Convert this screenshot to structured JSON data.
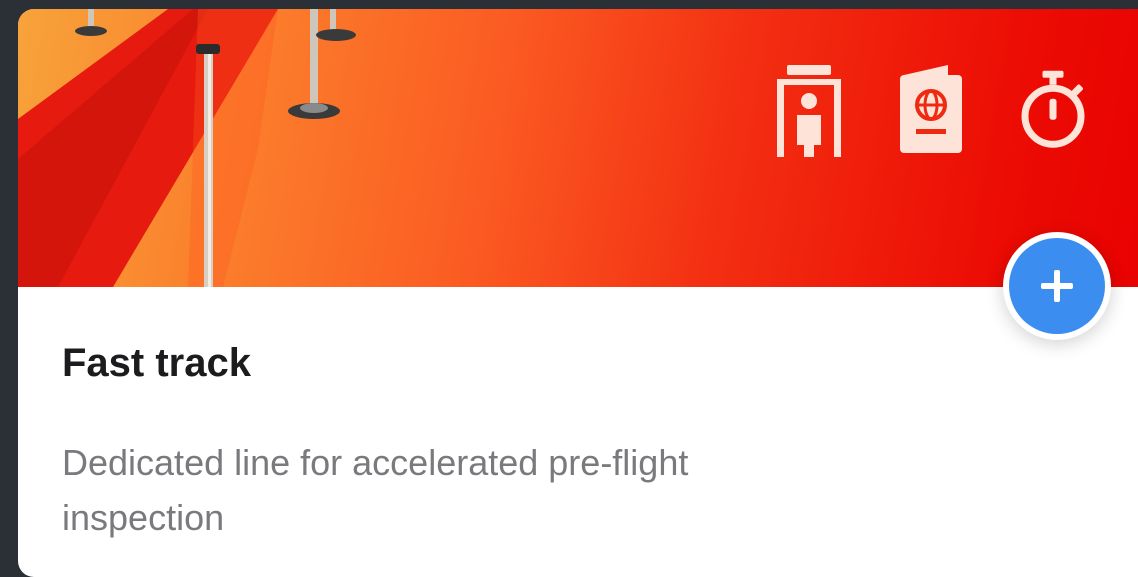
{
  "card": {
    "title": "Fast track",
    "description": "Dedicated line for accelerated pre-flight inspection"
  },
  "hero": {
    "icons": [
      "security-scanner-icon",
      "passport-icon",
      "stopwatch-icon"
    ],
    "gradient_start": "#f7a33a",
    "gradient_end": "#e80000",
    "icon_color": "#fde3d8"
  },
  "add_button": {
    "icon": "plus-icon",
    "color": "#3b8ef0"
  }
}
